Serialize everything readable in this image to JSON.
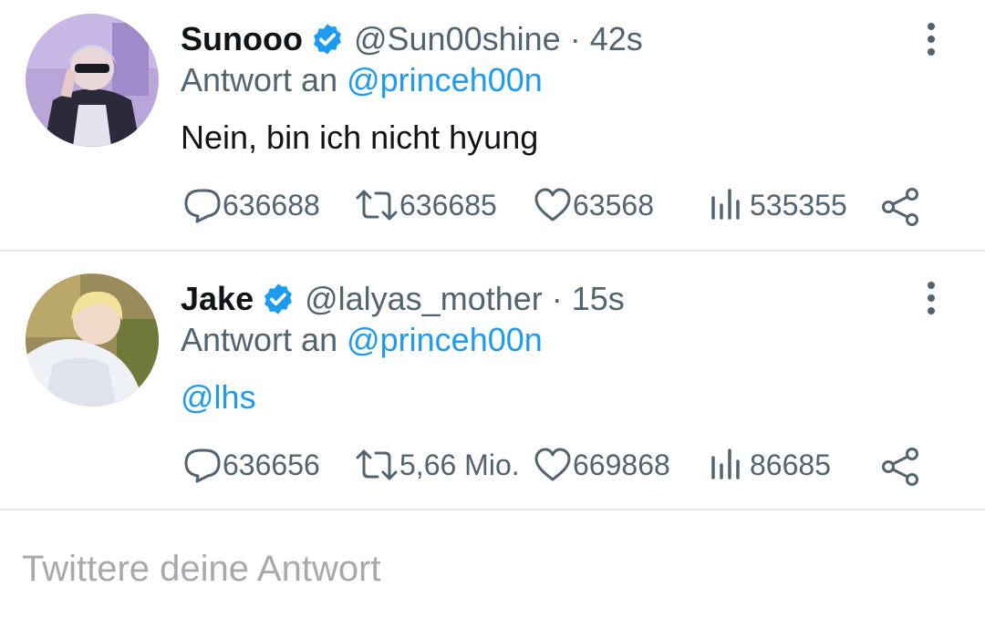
{
  "tweets": [
    {
      "name": "Sunooo",
      "handle": "@Sun00shine",
      "time": "42s",
      "reply_prefix": "Antwort an",
      "reply_mention": "@princeh00n",
      "text": "Nein, bin ich nicht hyung",
      "replies": "636688",
      "retweets": "636685",
      "likes": "63568",
      "views": "535355"
    },
    {
      "name": "Jake",
      "handle": "@lalyas_mother",
      "time": "15s",
      "reply_prefix": "Antwort an",
      "reply_mention": "@princeh00n",
      "text": "@lhs",
      "replies": "636656",
      "retweets": "5,66 Mio.",
      "likes": "669868",
      "views": "86685"
    }
  ],
  "separator": "·",
  "compose": {
    "placeholder": "Twittere deine Antwort"
  },
  "colors": {
    "accent": "#1d9bf0",
    "secondary_text": "#536471",
    "divider": "#e6e9eb"
  },
  "icons": [
    "verified-badge-icon",
    "more-vertical-icon",
    "reply-icon",
    "retweet-icon",
    "like-icon",
    "views-icon",
    "share-icon"
  ]
}
